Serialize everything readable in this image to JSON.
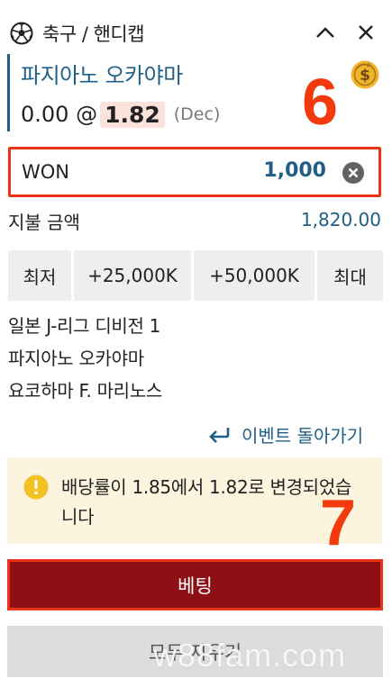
{
  "header": {
    "breadcrumb": "축구 / 핸디캡",
    "icons": {
      "sport": "soccer-ball-icon",
      "collapse": "chevron-up-icon",
      "close": "close-icon"
    }
  },
  "selection": {
    "team": "파지아노 오카야마",
    "handicap_prefix": "0.00 @",
    "odds": "1.82",
    "odds_format": "(Dec)",
    "coin_icon": "coin-icon"
  },
  "annotations": {
    "step_six": "6",
    "step_seven": "7"
  },
  "stake": {
    "currency": "WON",
    "amount": "1,000",
    "clear_icon": "clear-circle-icon"
  },
  "payout": {
    "label": "지불 금액",
    "value": "1,820.00"
  },
  "quick_stakes": [
    "최저",
    "+25,000K",
    "+50,000K",
    "최대"
  ],
  "match_info": {
    "league": "일본 J-리그 디비전 1",
    "home": "파지아노 오카야마",
    "away": "요코하마 F. 마리노스"
  },
  "back_link": {
    "label": "이벤트 돌아가기",
    "icon": "return-arrow-icon"
  },
  "odds_change": {
    "message": "배당률이 1.85에서 1.82로 변경되었습니다",
    "icon": "warning-icon"
  },
  "actions": {
    "bet": "베팅",
    "clear_all": "모두 지우기"
  },
  "watermark": "w88fam.com",
  "colors": {
    "accent_blue": "#1f5f87",
    "bet_button": "#8e1015",
    "annotation_red": "#f33a0c",
    "warning_bg": "#fdf4dd",
    "warning_icon": "#f2c224",
    "coin": "#f0b429"
  }
}
